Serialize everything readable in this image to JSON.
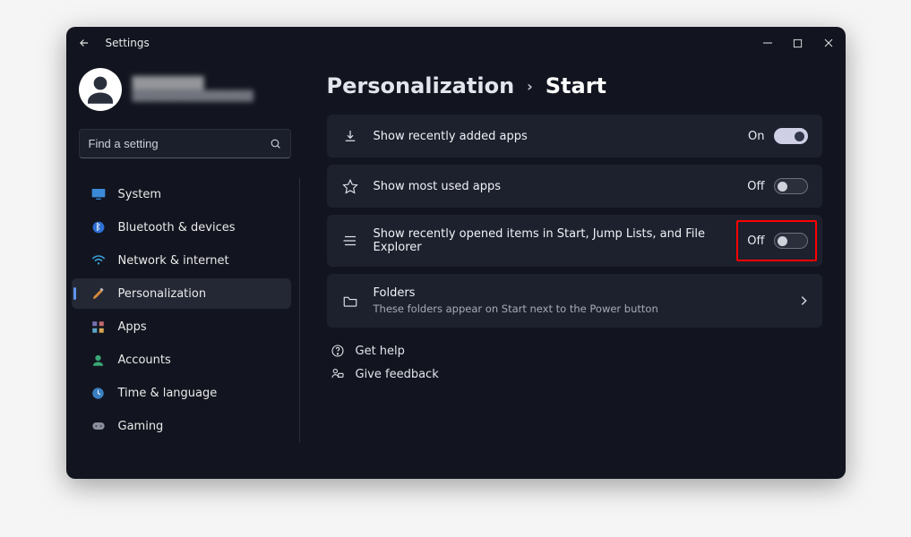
{
  "window": {
    "title": "Settings"
  },
  "profile": {
    "name": "████████",
    "sub": "████████████████"
  },
  "search": {
    "placeholder": "Find a setting"
  },
  "nav": {
    "items": [
      {
        "label": "System"
      },
      {
        "label": "Bluetooth & devices"
      },
      {
        "label": "Network & internet"
      },
      {
        "label": "Personalization"
      },
      {
        "label": "Apps"
      },
      {
        "label": "Accounts"
      },
      {
        "label": "Time & language"
      },
      {
        "label": "Gaming"
      }
    ]
  },
  "breadcrumb": {
    "parent": "Personalization",
    "separator": "›",
    "current": "Start"
  },
  "settings": [
    {
      "title": "Show recently added apps",
      "state_label": "On",
      "on": true
    },
    {
      "title": "Show most used apps",
      "state_label": "Off",
      "on": false
    },
    {
      "title": "Show recently opened items in Start, Jump Lists, and File Explorer",
      "state_label": "Off",
      "on": false,
      "highlight": true
    }
  ],
  "folders": {
    "title": "Folders",
    "sub": "These folders appear on Start next to the Power button"
  },
  "footer": {
    "help": "Get help",
    "feedback": "Give feedback"
  }
}
